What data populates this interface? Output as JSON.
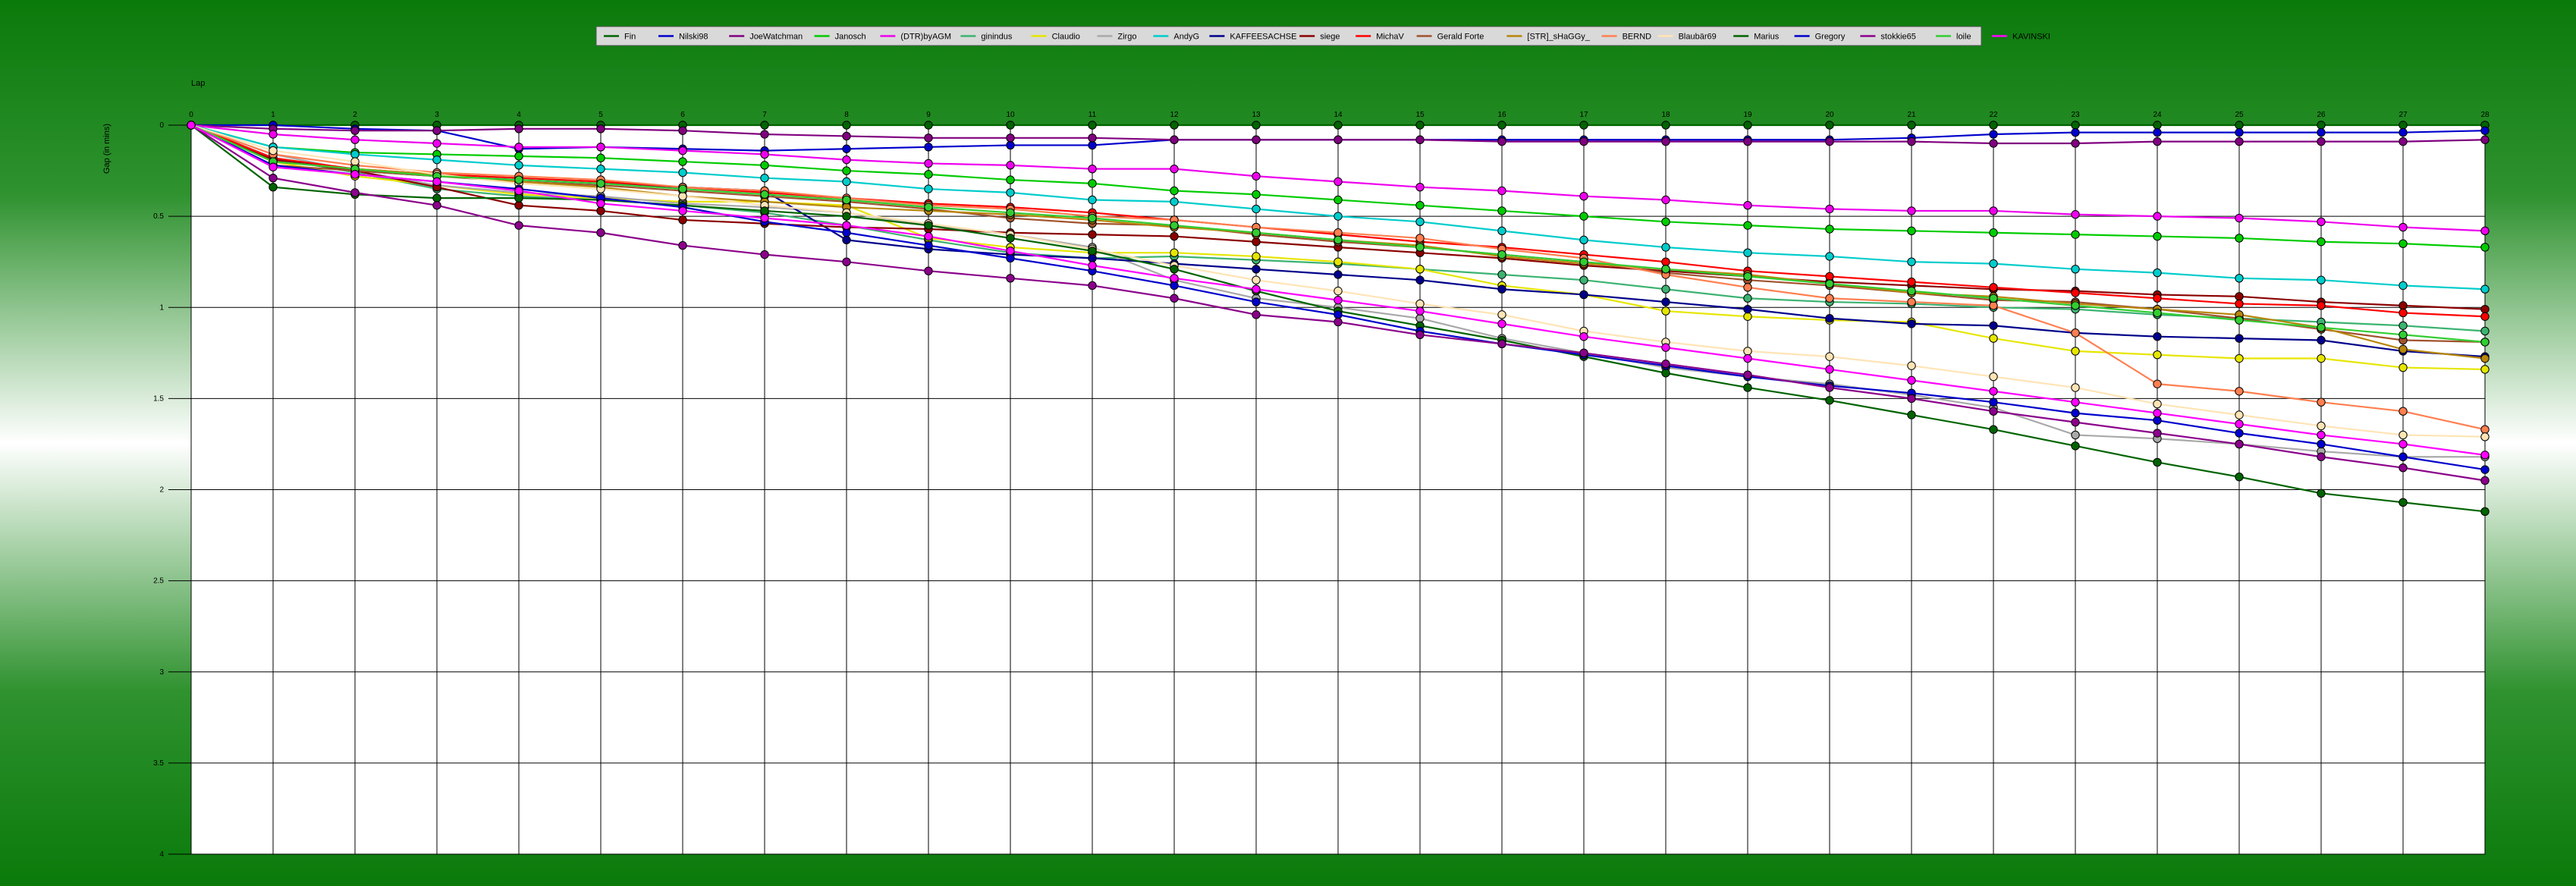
{
  "chart_data": {
    "type": "line",
    "xlabel": "Lap",
    "ylabel": "Gap (in mins)",
    "xlim": [
      0,
      28
    ],
    "ylim": [
      0,
      4
    ],
    "ytick_values": [
      0,
      0.5,
      1,
      1.5,
      2,
      2.5,
      3,
      3.5,
      4
    ],
    "ytick_labels": [
      "0",
      "0.5",
      "1",
      "1.5",
      "2",
      "2.5",
      "3",
      "3.5",
      "4"
    ],
    "xtick_labels": [
      "0",
      "1",
      "2",
      "3",
      "4",
      "5",
      "6",
      "7",
      "8",
      "9",
      "10",
      "11",
      "12",
      "13",
      "14",
      "15",
      "16",
      "17",
      "18",
      "19",
      "20",
      "21",
      "22",
      "23",
      "24",
      "25",
      "26",
      "27",
      "28"
    ],
    "grid": true,
    "legend_position": "top",
    "series": [
      {
        "name": "Fin",
        "color": "#006400",
        "values": [
          0,
          0,
          0,
          0,
          0,
          0,
          0,
          0,
          0,
          0,
          0,
          0,
          0,
          0,
          0,
          0,
          0,
          0,
          0,
          0,
          0,
          0,
          0,
          0,
          0,
          0,
          0,
          0,
          0
        ]
      },
      {
        "name": "Nilski98",
        "color": "#0000cc",
        "values": [
          0,
          0,
          0.02,
          0.03,
          0.13,
          0.12,
          0.13,
          0.14,
          0.13,
          0.12,
          0.11,
          0.11,
          0.08,
          0.08,
          0.08,
          0.08,
          0.08,
          0.08,
          0.08,
          0.08,
          0.08,
          0.07,
          0.05,
          0.04,
          0.04,
          0.04,
          0.04,
          0.04,
          0.03
        ]
      },
      {
        "name": "JoeWatchman",
        "color": "#800080",
        "values": [
          0,
          0.02,
          0.03,
          0.03,
          0.02,
          0.02,
          0.03,
          0.05,
          0.06,
          0.07,
          0.07,
          0.07,
          0.08,
          0.08,
          0.08,
          0.08,
          0.09,
          0.09,
          0.09,
          0.09,
          0.09,
          0.09,
          0.1,
          0.1,
          0.09,
          0.09,
          0.09,
          0.09,
          0.08
        ]
      },
      {
        "name": "Janosch",
        "color": "#00cc00",
        "values": [
          0,
          0.12,
          0.15,
          0.16,
          0.17,
          0.18,
          0.2,
          0.22,
          0.25,
          0.27,
          0.3,
          0.32,
          0.36,
          0.38,
          0.41,
          0.44,
          0.47,
          0.5,
          0.53,
          0.55,
          0.57,
          0.58,
          0.59,
          0.6,
          0.61,
          0.62,
          0.64,
          0.65,
          0.67
        ]
      },
      {
        "name": "(DTR)byAGM",
        "color": "#ee00ee",
        "values": [
          0,
          0.05,
          0.08,
          0.1,
          0.12,
          0.12,
          0.14,
          0.16,
          0.19,
          0.21,
          0.22,
          0.24,
          0.24,
          0.28,
          0.31,
          0.34,
          0.36,
          0.39,
          0.41,
          0.44,
          0.46,
          0.47,
          0.47,
          0.49,
          0.5,
          0.51,
          0.53,
          0.56,
          0.58
        ]
      },
      {
        "name": "ginindus",
        "color": "#3cb371",
        "values": [
          0,
          0.18,
          0.26,
          0.35,
          0.39,
          0.41,
          0.44,
          0.48,
          0.55,
          0.63,
          0.7,
          0.73,
          0.72,
          0.74,
          0.76,
          0.79,
          0.82,
          0.85,
          0.9,
          0.95,
          0.97,
          0.98,
          1.0,
          1.01,
          1.04,
          1.06,
          1.08,
          1.1,
          1.13
        ]
      },
      {
        "name": "Claudio",
        "color": "#e6e600",
        "values": [
          0,
          0.2,
          0.28,
          0.33,
          0.38,
          0.4,
          0.42,
          0.42,
          0.44,
          0.62,
          0.67,
          0.7,
          0.7,
          0.72,
          0.75,
          0.79,
          0.88,
          0.93,
          1.02,
          1.05,
          1.07,
          1.08,
          1.17,
          1.24,
          1.26,
          1.28,
          1.28,
          1.33,
          1.34
        ]
      },
      {
        "name": "Zirgo",
        "color": "#a9a9a9",
        "values": [
          0,
          0.16,
          0.25,
          0.33,
          0.37,
          0.39,
          0.43,
          0.45,
          0.48,
          0.55,
          0.6,
          0.67,
          0.85,
          0.95,
          1.0,
          1.06,
          1.17,
          1.25,
          1.33,
          1.38,
          1.42,
          1.48,
          1.55,
          1.7,
          1.72,
          1.75,
          1.79,
          1.82,
          1.82
        ]
      },
      {
        "name": "AndyG",
        "color": "#00cccc",
        "values": [
          0,
          0.12,
          0.16,
          0.19,
          0.22,
          0.24,
          0.26,
          0.29,
          0.31,
          0.35,
          0.37,
          0.41,
          0.42,
          0.46,
          0.5,
          0.53,
          0.58,
          0.63,
          0.67,
          0.7,
          0.72,
          0.75,
          0.76,
          0.79,
          0.81,
          0.84,
          0.85,
          0.88,
          0.9
        ]
      },
      {
        "name": "KAFFEESACHSE",
        "color": "#00008b",
        "values": [
          0,
          0.18,
          0.25,
          0.28,
          0.3,
          0.32,
          0.34,
          0.36,
          0.63,
          0.68,
          0.71,
          0.73,
          0.76,
          0.79,
          0.82,
          0.85,
          0.9,
          0.93,
          0.97,
          1.01,
          1.06,
          1.09,
          1.1,
          1.14,
          1.16,
          1.17,
          1.18,
          1.24,
          1.27
        ]
      },
      {
        "name": "siege",
        "color": "#8b0000",
        "values": [
          0,
          0.19,
          0.25,
          0.34,
          0.44,
          0.47,
          0.52,
          0.54,
          0.56,
          0.57,
          0.59,
          0.6,
          0.61,
          0.64,
          0.67,
          0.7,
          0.73,
          0.77,
          0.8,
          0.83,
          0.86,
          0.88,
          0.9,
          0.91,
          0.93,
          0.94,
          0.97,
          0.99,
          1.01
        ]
      },
      {
        "name": "MichaV",
        "color": "#ff0000",
        "values": [
          0,
          0.18,
          0.24,
          0.27,
          0.29,
          0.31,
          0.34,
          0.37,
          0.4,
          0.43,
          0.45,
          0.48,
          0.52,
          0.56,
          0.6,
          0.64,
          0.67,
          0.71,
          0.75,
          0.8,
          0.83,
          0.86,
          0.89,
          0.92,
          0.95,
          0.98,
          0.99,
          1.03,
          1.05
        ]
      },
      {
        "name": "Gerald Forte",
        "color": "#a0522d",
        "values": [
          0,
          0.22,
          0.25,
          0.28,
          0.31,
          0.33,
          0.36,
          0.39,
          0.42,
          0.46,
          0.51,
          0.54,
          0.55,
          0.6,
          0.64,
          0.67,
          0.71,
          0.75,
          0.81,
          0.85,
          0.88,
          0.92,
          0.96,
          0.97,
          1.01,
          1.06,
          1.12,
          1.18,
          1.19
        ]
      },
      {
        "name": "[STR]_sHaGGy_",
        "color": "#b8860b",
        "values": [
          0,
          0.2,
          0.24,
          0.27,
          0.31,
          0.34,
          0.39,
          0.42,
          0.45,
          0.47,
          0.49,
          0.52,
          0.56,
          0.59,
          0.63,
          0.66,
          0.72,
          0.76,
          0.79,
          0.82,
          0.87,
          0.92,
          0.94,
          0.98,
          1.01,
          1.04,
          1.11,
          1.23,
          1.28
        ]
      },
      {
        "name": "BERND",
        "color": "#ff7f50",
        "values": [
          0,
          0.16,
          0.22,
          0.26,
          0.28,
          0.3,
          0.34,
          0.36,
          0.4,
          0.44,
          0.46,
          0.5,
          0.52,
          0.56,
          0.59,
          0.62,
          0.68,
          0.73,
          0.82,
          0.89,
          0.95,
          0.97,
          0.99,
          1.14,
          1.42,
          1.46,
          1.52,
          1.57,
          1.67
        ]
      },
      {
        "name": "Blaubär69",
        "color": "#ffe4b5",
        "values": [
          0,
          0.14,
          0.2,
          0.27,
          0.32,
          0.35,
          0.39,
          0.44,
          0.48,
          0.54,
          0.6,
          0.68,
          0.77,
          0.85,
          0.91,
          0.98,
          1.04,
          1.13,
          1.19,
          1.24,
          1.27,
          1.32,
          1.38,
          1.44,
          1.53,
          1.59,
          1.65,
          1.7,
          1.71
        ]
      },
      {
        "name": "Marius",
        "color": "#006400",
        "values": [
          0,
          0.34,
          0.38,
          0.4,
          0.4,
          0.41,
          0.44,
          0.47,
          0.5,
          0.55,
          0.62,
          0.69,
          0.79,
          0.91,
          1.02,
          1.1,
          1.18,
          1.27,
          1.36,
          1.44,
          1.51,
          1.59,
          1.67,
          1.76,
          1.85,
          1.93,
          2.02,
          2.07,
          2.12
        ]
      },
      {
        "name": "Gregory",
        "color": "#0000cd",
        "values": [
          0,
          0.22,
          0.27,
          0.31,
          0.35,
          0.4,
          0.45,
          0.53,
          0.59,
          0.66,
          0.73,
          0.8,
          0.88,
          0.97,
          1.04,
          1.13,
          1.2,
          1.26,
          1.32,
          1.38,
          1.43,
          1.47,
          1.52,
          1.58,
          1.62,
          1.69,
          1.75,
          1.82,
          1.89
        ]
      },
      {
        "name": "stokkie65",
        "color": "#8b008b",
        "values": [
          0,
          0.29,
          0.37,
          0.44,
          0.55,
          0.59,
          0.66,
          0.71,
          0.75,
          0.8,
          0.84,
          0.88,
          0.95,
          1.04,
          1.08,
          1.15,
          1.2,
          1.25,
          1.31,
          1.37,
          1.44,
          1.5,
          1.57,
          1.63,
          1.69,
          1.75,
          1.82,
          1.88,
          1.95
        ]
      },
      {
        "name": "loile",
        "color": "#32cd32",
        "values": [
          0,
          0.2,
          0.24,
          0.28,
          0.3,
          0.32,
          0.35,
          0.38,
          0.41,
          0.45,
          0.48,
          0.51,
          0.55,
          0.59,
          0.63,
          0.67,
          0.71,
          0.75,
          0.79,
          0.83,
          0.87,
          0.91,
          0.95,
          0.99,
          1.03,
          1.07,
          1.11,
          1.15,
          1.19
        ]
      },
      {
        "name": "KAVINSKI",
        "color": "#ff00ff",
        "values": [
          0,
          0.23,
          0.27,
          0.31,
          0.36,
          0.43,
          0.47,
          0.51,
          0.55,
          0.61,
          0.69,
          0.77,
          0.84,
          0.9,
          0.96,
          1.02,
          1.09,
          1.16,
          1.22,
          1.28,
          1.34,
          1.4,
          1.46,
          1.52,
          1.58,
          1.64,
          1.7,
          1.75,
          1.81
        ]
      }
    ]
  }
}
